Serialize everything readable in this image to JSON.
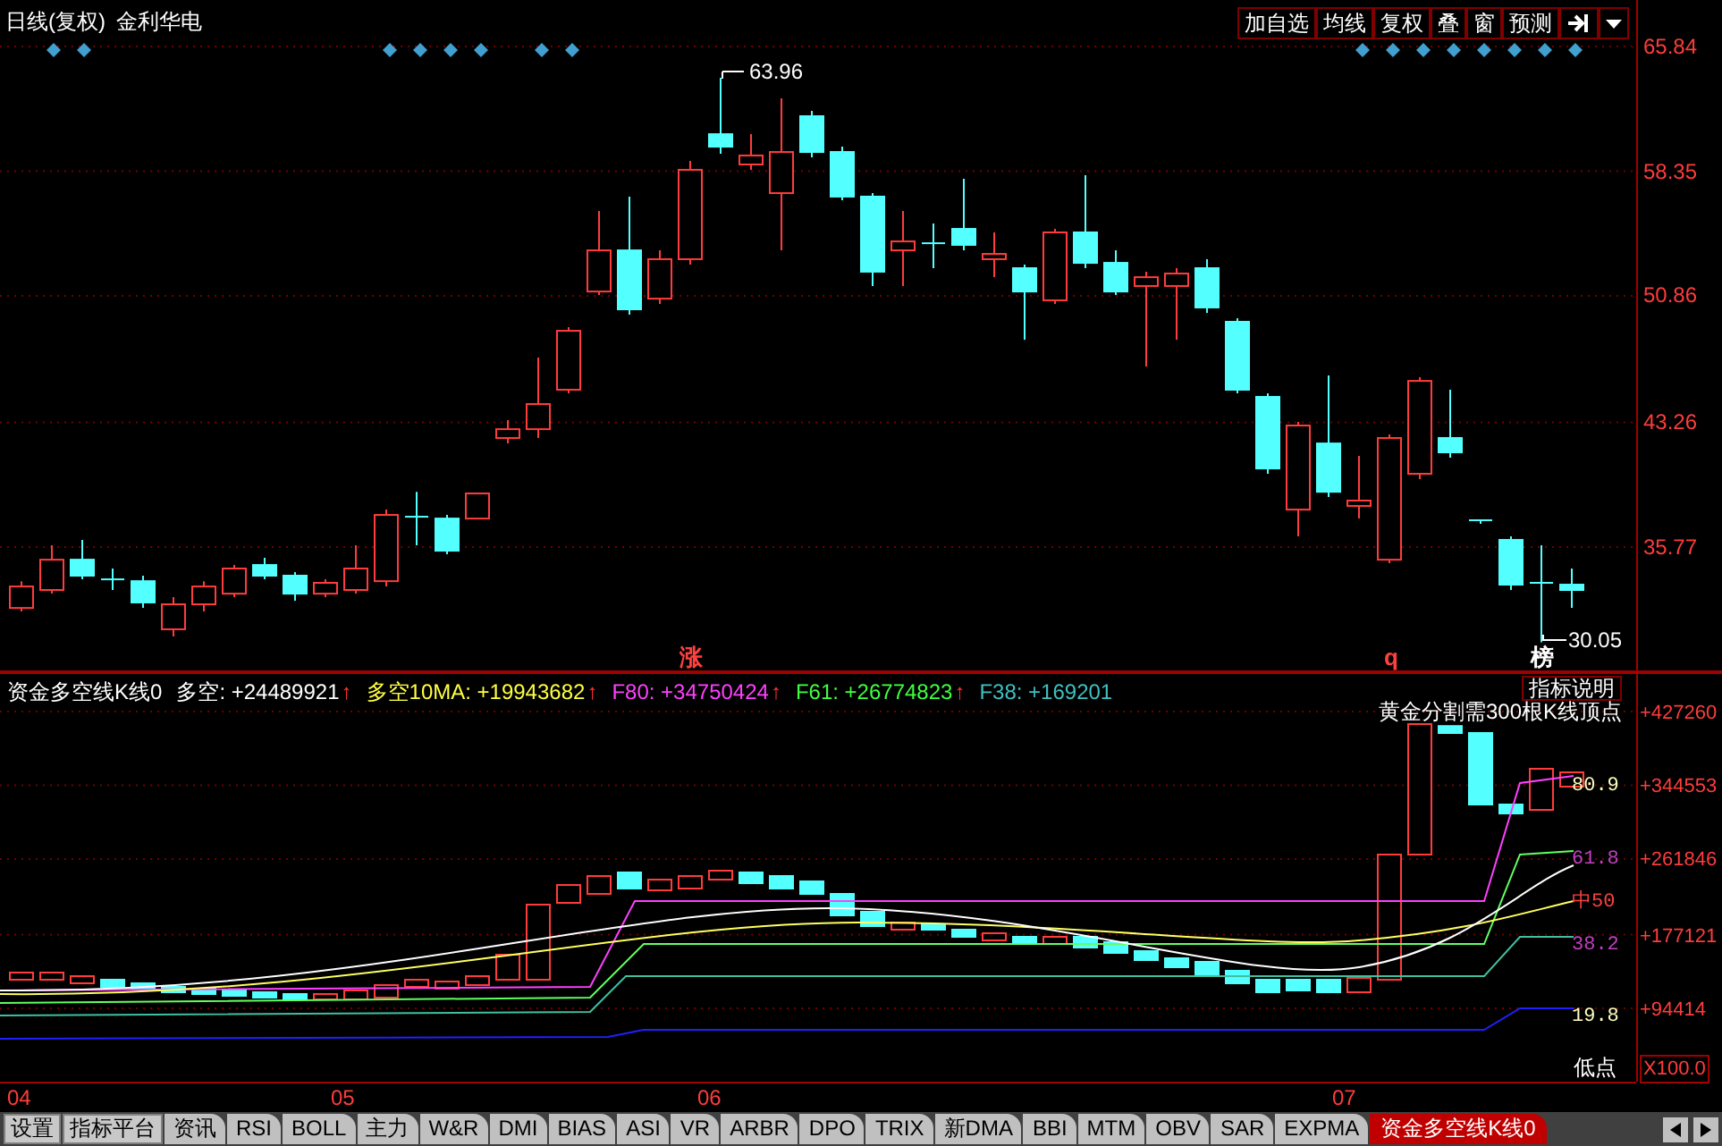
{
  "header": {
    "period": "日线(复权)",
    "stock": "金利华电",
    "buttons": [
      "加自选",
      "均线",
      "复权",
      "叠",
      "窗",
      "预测"
    ]
  },
  "price_panel": {
    "high_label": "63.96",
    "low_label": "30.05",
    "markers": [
      {
        "text": "涨",
        "color": "#ff4040"
      },
      {
        "text": "q",
        "color": "#ff4040"
      },
      {
        "text": "榜",
        "color": "#ffffff"
      }
    ],
    "chart_data": {
      "type": "candlestick",
      "ylim": [
        28.25,
        68.63
      ],
      "grid": true,
      "yticks": [
        35.77,
        43.26,
        50.86,
        58.35,
        65.84
      ],
      "ohlc": [
        [
          32.11,
          33.72,
          31.9,
          33.4
        ],
        [
          33.19,
          35.87,
          32.97,
          35.01
        ],
        [
          35.01,
          36.2,
          33.83,
          34.05
        ],
        [
          33.83,
          34.48,
          33.19,
          33.83
        ],
        [
          33.72,
          34.05,
          32.11,
          32.44
        ],
        [
          30.83,
          32.76,
          30.4,
          32.33
        ],
        [
          32.33,
          33.72,
          31.9,
          33.4
        ],
        [
          32.97,
          34.69,
          32.76,
          34.48
        ],
        [
          34.69,
          35.12,
          33.83,
          34.05
        ],
        [
          34.05,
          34.26,
          32.54,
          32.97
        ],
        [
          32.97,
          33.83,
          32.76,
          33.62
        ],
        [
          33.19,
          35.87,
          32.97,
          34.48
        ],
        [
          33.72,
          38.02,
          33.4,
          37.7
        ],
        [
          37.59,
          39.09,
          35.87,
          37.59
        ],
        [
          37.48,
          37.7,
          35.34,
          35.55
        ],
        [
          37.48,
          38.99,
          37.48,
          38.99
        ],
        [
          42.32,
          43.39,
          41.99,
          42.85
        ],
        [
          42.85,
          47.15,
          42.32,
          44.36
        ],
        [
          45.22,
          48.98,
          45.0,
          48.76
        ],
        [
          51.12,
          55.96,
          50.91,
          53.59
        ],
        [
          53.59,
          56.82,
          49.73,
          50.05
        ],
        [
          50.69,
          53.59,
          50.37,
          53.06
        ],
        [
          53.06,
          58.96,
          52.73,
          58.43
        ],
        [
          60.57,
          63.96,
          59.39,
          59.82
        ],
        [
          58.75,
          60.57,
          58.43,
          59.29
        ],
        [
          57.03,
          62.72,
          53.59,
          59.5
        ],
        [
          61.65,
          61.97,
          59.18,
          59.5
        ],
        [
          59.5,
          59.82,
          56.6,
          56.82
        ],
        [
          56.82,
          57.03,
          51.45,
          52.31
        ],
        [
          53.59,
          55.96,
          51.45,
          54.13
        ],
        [
          54.02,
          55.2,
          52.52,
          54.02
        ],
        [
          54.88,
          57.89,
          53.59,
          53.92
        ],
        [
          53.06,
          54.67,
          51.98,
          53.38
        ],
        [
          52.52,
          52.73,
          48.22,
          51.12
        ],
        [
          50.59,
          54.88,
          50.37,
          54.67
        ],
        [
          54.67,
          58.1,
          52.52,
          52.84
        ],
        [
          52.84,
          53.59,
          50.91,
          51.12
        ],
        [
          51.45,
          52.31,
          46.61,
          51.98
        ],
        [
          51.45,
          52.52,
          48.22,
          52.2
        ],
        [
          52.52,
          53.06,
          49.83,
          50.16
        ],
        [
          49.3,
          49.51,
          45.0,
          45.22
        ],
        [
          44.79,
          45.0,
          40.17,
          40.49
        ],
        [
          38.02,
          43.28,
          36.41,
          43.07
        ],
        [
          41.99,
          46.08,
          38.77,
          39.09
        ],
        [
          38.24,
          41.24,
          37.48,
          38.56
        ],
        [
          35.01,
          42.53,
          34.8,
          42.32
        ],
        [
          40.17,
          45.97,
          39.85,
          45.75
        ],
        [
          42.32,
          45.22,
          41.14,
          41.46
        ],
        [
          37.38,
          37.38,
          37.16,
          37.38
        ],
        [
          36.2,
          36.41,
          33.19,
          33.51
        ],
        [
          33.62,
          35.87,
          30.05,
          33.62
        ],
        [
          33.51,
          34.48,
          32.11,
          33.19
        ]
      ]
    }
  },
  "indicator_panel": {
    "name": "资金多空线K线0",
    "legend": [
      {
        "text": "多空: +24489921",
        "arrow": "↑",
        "color": "#ffffff"
      },
      {
        "text": "多空10MA: +19943682",
        "arrow": "↑",
        "color": "#ffff40"
      },
      {
        "text": "F80: +34750424",
        "arrow": "↑",
        "color": "#ff40ff"
      },
      {
        "text": "F61: +26774823",
        "arrow": "↑",
        "color": "#40ff40"
      },
      {
        "text": "F38: +169201",
        "color": "#40c0c0"
      }
    ],
    "help_button": "指标说明",
    "note": "黄金分割需300根K线顶点",
    "levels": [
      {
        "text": "80.9",
        "color": "#ffffc0"
      },
      {
        "text": "61.8",
        "color": "#c040c0"
      },
      {
        "text": "中50",
        "color": "#ff4040"
      },
      {
        "text": "38.2",
        "color": "#c040c0"
      },
      {
        "text": "19.8",
        "color": "#ffffc0"
      }
    ],
    "low_label": "低点",
    "scale": "X100.0",
    "chart_data": {
      "type": "candlestick",
      "ylim": [
        12204,
        471372
      ],
      "grid": true,
      "yticks": [
        {
          "value": 94414,
          "label": "+94414"
        },
        {
          "value": 177121,
          "label": "+177121"
        },
        {
          "value": 261846,
          "label": "+261846"
        },
        {
          "value": 344553,
          "label": "+344553"
        },
        {
          "value": 427260,
          "label": "+427260"
        }
      ],
      "ohlc": [
        [
          126510,
          134530,
          126510,
          134530
        ],
        [
          126510,
          134530,
          126510,
          134530
        ],
        [
          122500,
          130520,
          122500,
          130520
        ],
        [
          126510,
          126510,
          118490,
          118490
        ],
        [
          122500,
          122500,
          116485,
          116485
        ],
        [
          118490,
          118490,
          112475,
          112475
        ],
        [
          116485,
          116485,
          110470,
          110470
        ],
        [
          114480,
          114480,
          108465,
          108465
        ],
        [
          112475,
          112475,
          106460,
          106460
        ],
        [
          110470,
          110470,
          104455,
          104455
        ],
        [
          104455,
          110470,
          104455,
          110470
        ],
        [
          104455,
          114480,
          104455,
          114480
        ],
        [
          106460,
          120495,
          106460,
          120495
        ],
        [
          118490,
          126510,
          118490,
          126510
        ],
        [
          116485,
          124505,
          116485,
          124505
        ],
        [
          120495,
          130520,
          120495,
          130520
        ],
        [
          126510,
          154580,
          126510,
          154580
        ],
        [
          126510,
          210720,
          126510,
          210720
        ],
        [
          212725,
          232775,
          212725,
          232775
        ],
        [
          222750,
          242800,
          222750,
          242800
        ],
        [
          246810,
          246810,
          228765,
          228765
        ],
        [
          226760,
          238790,
          226760,
          238790
        ],
        [
          228765,
          242800,
          228765,
          242800
        ],
        [
          238790,
          248815,
          238790,
          248815
        ],
        [
          246810,
          246810,
          234780,
          234780
        ],
        [
          242800,
          242800,
          228765,
          228765
        ],
        [
          236785,
          236785,
          222750,
          222750
        ],
        [
          222750,
          222750,
          198690,
          198690
        ],
        [
          202700,
          202700,
          186660,
          186660
        ],
        [
          182650,
          190670,
          182650,
          190670
        ],
        [
          188665,
          188665,
          182650,
          182650
        ],
        [
          182650,
          182650,
          174630,
          174630
        ],
        [
          170620,
          178640,
          170620,
          178640
        ],
        [
          174630,
          174630,
          166610,
          166610
        ],
        [
          166610,
          174630,
          166610,
          174630
        ],
        [
          174630,
          174630,
          162600,
          162600
        ],
        [
          168615,
          168615,
          156585,
          156585
        ],
        [
          158590,
          158590,
          148565,
          148565
        ],
        [
          150570,
          150570,
          140545,
          140545
        ],
        [
          146560,
          146560,
          132525,
          132525
        ],
        [
          136535,
          136535,
          122500,
          122500
        ],
        [
          126510,
          126510,
          112475,
          112475
        ],
        [
          126510,
          126510,
          114480,
          114480
        ],
        [
          126510,
          126510,
          112475,
          112475
        ],
        [
          112475,
          128515,
          112475,
          128515
        ],
        [
          126510,
          266860,
          126510,
          266860
        ],
        [
          266860,
          413225,
          266860,
          413225
        ],
        [
          411000,
          411000,
          403200,
          403200
        ],
        [
          403200,
          403200,
          323000,
          323000
        ],
        [
          323000,
          323000,
          312975,
          312975
        ],
        [
          316985,
          363100,
          316985,
          363100
        ],
        [
          343050,
          359090,
          343050,
          359090
        ]
      ]
    }
  },
  "date_axis": [
    "04",
    "05",
    "06",
    "07"
  ],
  "tabs": [
    {
      "label": "设置",
      "kind": "button"
    },
    {
      "label": "指标平台",
      "kind": "button"
    },
    {
      "label": "资讯",
      "kind": "tab",
      "selected": false
    },
    {
      "label": "RSI",
      "kind": "tab",
      "selected": false
    },
    {
      "label": "BOLL",
      "kind": "tab",
      "selected": false
    },
    {
      "label": "主力",
      "kind": "tab",
      "selected": false
    },
    {
      "label": "W&R",
      "kind": "tab",
      "selected": false
    },
    {
      "label": "DMI",
      "kind": "tab",
      "selected": false
    },
    {
      "label": "BIAS",
      "kind": "tab",
      "selected": false
    },
    {
      "label": "ASI",
      "kind": "tab",
      "selected": false
    },
    {
      "label": "VR",
      "kind": "tab",
      "selected": false
    },
    {
      "label": "ARBR",
      "kind": "tab",
      "selected": false
    },
    {
      "label": "DPO",
      "kind": "tab",
      "selected": false
    },
    {
      "label": "TRIX",
      "kind": "tab",
      "selected": false
    },
    {
      "label": "新DMA",
      "kind": "tab",
      "selected": false
    },
    {
      "label": "BBI",
      "kind": "tab",
      "selected": false
    },
    {
      "label": "MTM",
      "kind": "tab",
      "selected": false
    },
    {
      "label": "OBV",
      "kind": "tab",
      "selected": false
    },
    {
      "label": "SAR",
      "kind": "tab",
      "selected": false
    },
    {
      "label": "EXPMA",
      "kind": "tab",
      "selected": false
    },
    {
      "label": "资金多空线K线0",
      "kind": "tab",
      "selected": true
    }
  ]
}
